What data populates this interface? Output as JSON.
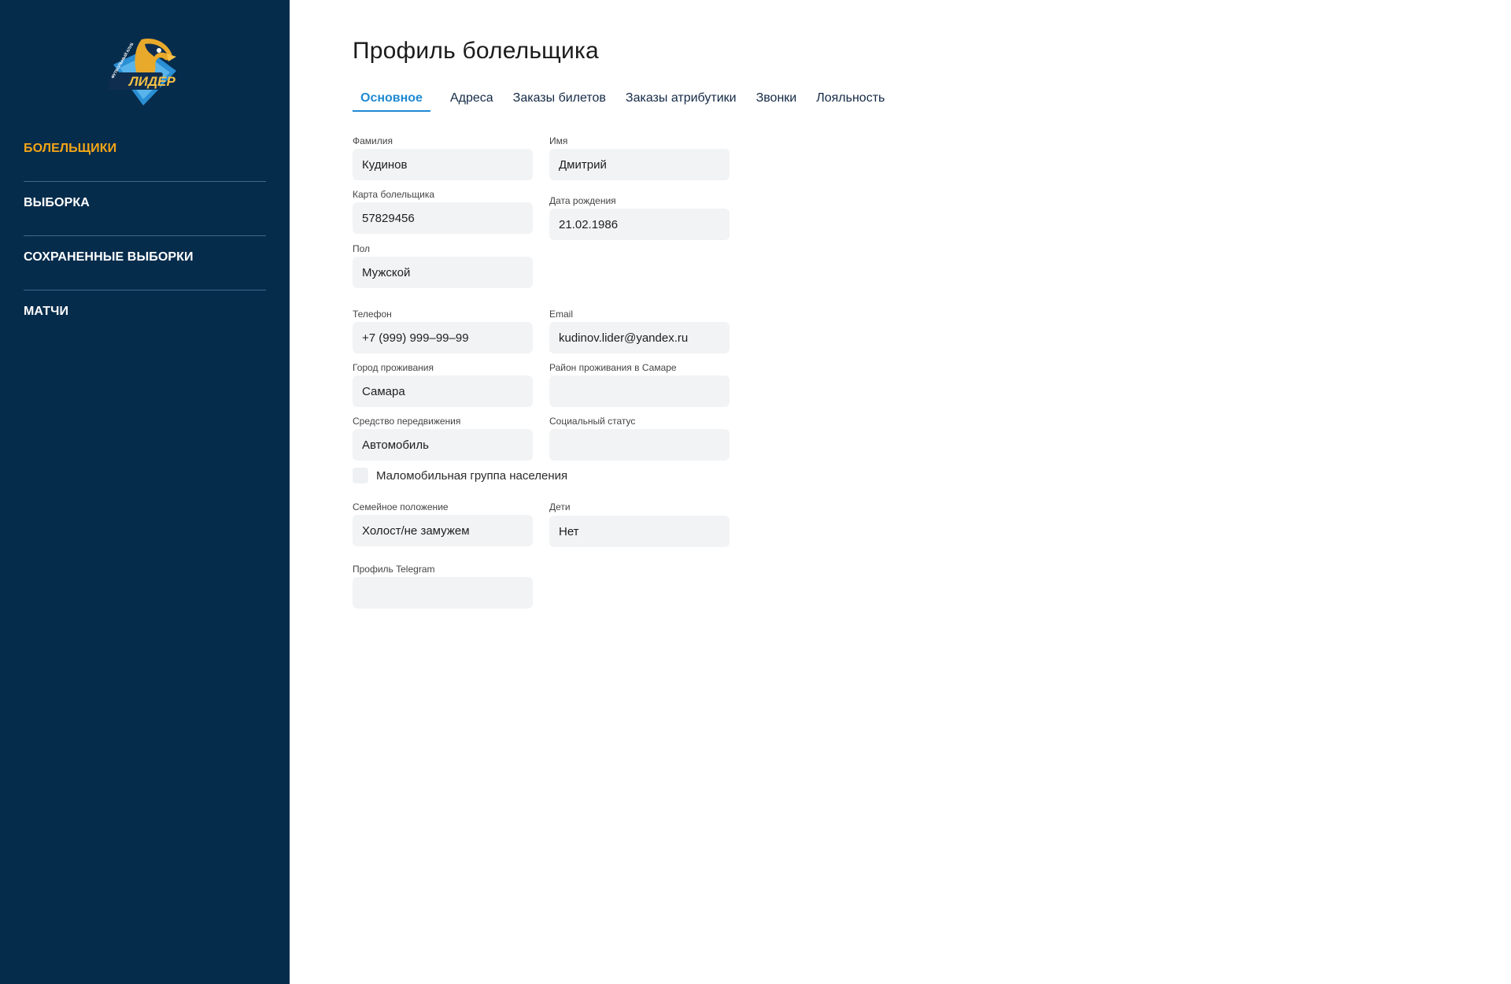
{
  "brand": {
    "logo_text": "ЛИДЕР",
    "logo_subtext": "ФУТБОЛЬНЫЙ КЛУБ",
    "colors": {
      "sidebar": "#062c4c",
      "accent": "#f4a616",
      "tab_active": "#1f8ad3"
    }
  },
  "sidebar": {
    "items": [
      {
        "label": "БОЛЕЛЬЩИКИ"
      },
      {
        "label": "ВЫБОРКА"
      },
      {
        "label": "СОХРАНЕННЫЕ ВЫБОРКИ"
      },
      {
        "label": "МАТЧИ"
      }
    ]
  },
  "page": {
    "title": "Профиль болельщика"
  },
  "tabs": [
    {
      "label": "Основное",
      "active": true
    },
    {
      "label": "Адреса"
    },
    {
      "label": "Заказы билетов"
    },
    {
      "label": "Заказы атрибутики"
    },
    {
      "label": "Звонки"
    },
    {
      "label": "Лояльность"
    }
  ],
  "form": {
    "last_name": {
      "label": "Фамилия",
      "value": "Кудинов"
    },
    "first_name": {
      "label": "Имя",
      "value": "Дмитрий"
    },
    "fan_card": {
      "label": "Карта болельщика",
      "value": "57829456"
    },
    "birth_date": {
      "label": "Дата рождения",
      "value": "21.02.1986"
    },
    "gender": {
      "label": "Пол",
      "value": "Мужской"
    },
    "phone": {
      "label": "Телефон",
      "value": "+7 (999) 999–99–99"
    },
    "email": {
      "label": "Email",
      "value": "kudinov.lider@yandex.ru"
    },
    "city": {
      "label": "Город проживания",
      "value": "Самара"
    },
    "district": {
      "label": "Район проживания в Самаре",
      "value": ""
    },
    "transport": {
      "label": "Средство передвижения",
      "value": "Автомобиль"
    },
    "social_status": {
      "label": "Социальный статус",
      "value": ""
    },
    "low_mobility": {
      "label": "Маломобильная группа населения",
      "checked": false
    },
    "marital_status": {
      "label": "Семейное положение",
      "value": "Холост/не замужем"
    },
    "children": {
      "label": "Дети",
      "value": "Нет"
    },
    "telegram": {
      "label": "Профиль Telegram",
      "value": ""
    }
  }
}
